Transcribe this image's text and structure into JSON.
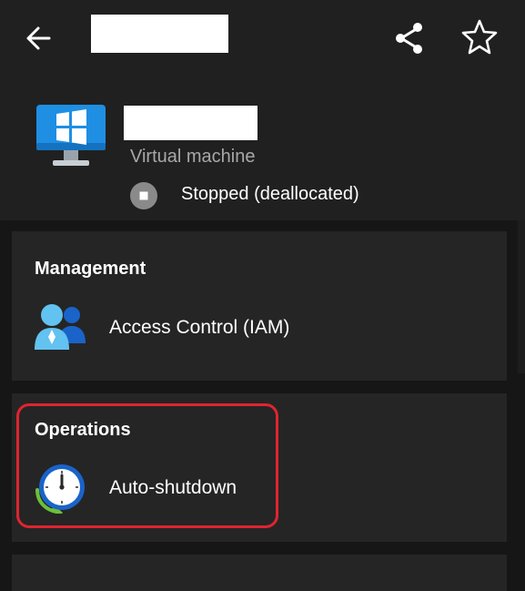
{
  "resource": {
    "type_label": "Virtual machine",
    "status": "Stopped (deallocated)"
  },
  "icons": {
    "back": "arrow-left-icon",
    "share": "share-icon",
    "favorite": "star-outline-icon",
    "resource": "windows-vm-icon",
    "status": "stopped-status-icon",
    "iam": "users-icon",
    "auto_shutdown": "clock-icon"
  },
  "sections": {
    "management": {
      "title": "Management",
      "items": [
        {
          "label": "Access Control (IAM)"
        }
      ]
    },
    "operations": {
      "title": "Operations",
      "items": [
        {
          "label": "Auto-shutdown"
        }
      ]
    }
  },
  "colors": {
    "background": "#161616",
    "header": "#202020",
    "card": "#252525",
    "highlight": "#e0242f",
    "azure_blue": "#1e8fe3"
  }
}
